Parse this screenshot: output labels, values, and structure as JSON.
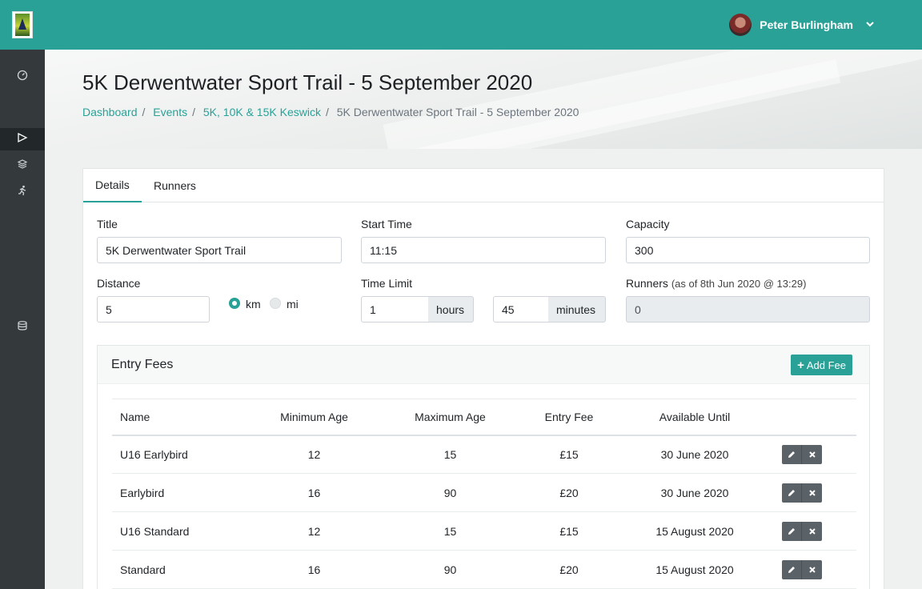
{
  "user": {
    "name": "Peter Burlingham"
  },
  "page": {
    "title": "5K Derwentwater Sport Trail - 5 September 2020",
    "breadcrumb": [
      "Dashboard",
      "Events",
      "5K, 10K & 15K Keswick",
      "5K Derwentwater Sport Trail - 5 September 2020"
    ]
  },
  "tabs": [
    "Details",
    "Runners"
  ],
  "form": {
    "title_label": "Title",
    "title_value": "5K Derwentwater Sport Trail",
    "start_label": "Start Time",
    "start_value": "11:15",
    "capacity_label": "Capacity",
    "capacity_value": "300",
    "distance_label": "Distance",
    "distance_value": "5",
    "unit_km": "km",
    "unit_mi": "mi",
    "selected_unit": "km",
    "timelimit_label": "Time Limit",
    "hours_value": "1",
    "hours_addon": "hours",
    "minutes_value": "45",
    "minutes_addon": "minutes",
    "runners_label": "Runners",
    "runners_note": "(as of 8th Jun 2020 @ 13:29)",
    "runners_value": "0"
  },
  "fees": {
    "title": "Entry Fees",
    "add_label": "Add Fee",
    "columns": [
      "Name",
      "Minimum Age",
      "Maximum Age",
      "Entry Fee",
      "Available Until"
    ],
    "rows": [
      [
        "U16 Earlybird",
        "12",
        "15",
        "£15",
        "30 June 2020"
      ],
      [
        "Earlybird",
        "16",
        "90",
        "£20",
        "30 June 2020"
      ],
      [
        "U16 Standard",
        "12",
        "15",
        "£15",
        "15 August 2020"
      ],
      [
        "Standard",
        "16",
        "90",
        "£20",
        "15 August 2020"
      ]
    ]
  },
  "colors": {
    "accent": "#2aa197",
    "sidebar": "#343a3c",
    "sidebar_active": "#222729",
    "button_dark": "#5a6268"
  },
  "icons": {
    "sidebar": [
      "dashboard-icon",
      "flag-icon",
      "layers-icon",
      "runner-icon",
      "database-icon"
    ],
    "row_actions": [
      "pencil-icon",
      "close-icon"
    ]
  }
}
